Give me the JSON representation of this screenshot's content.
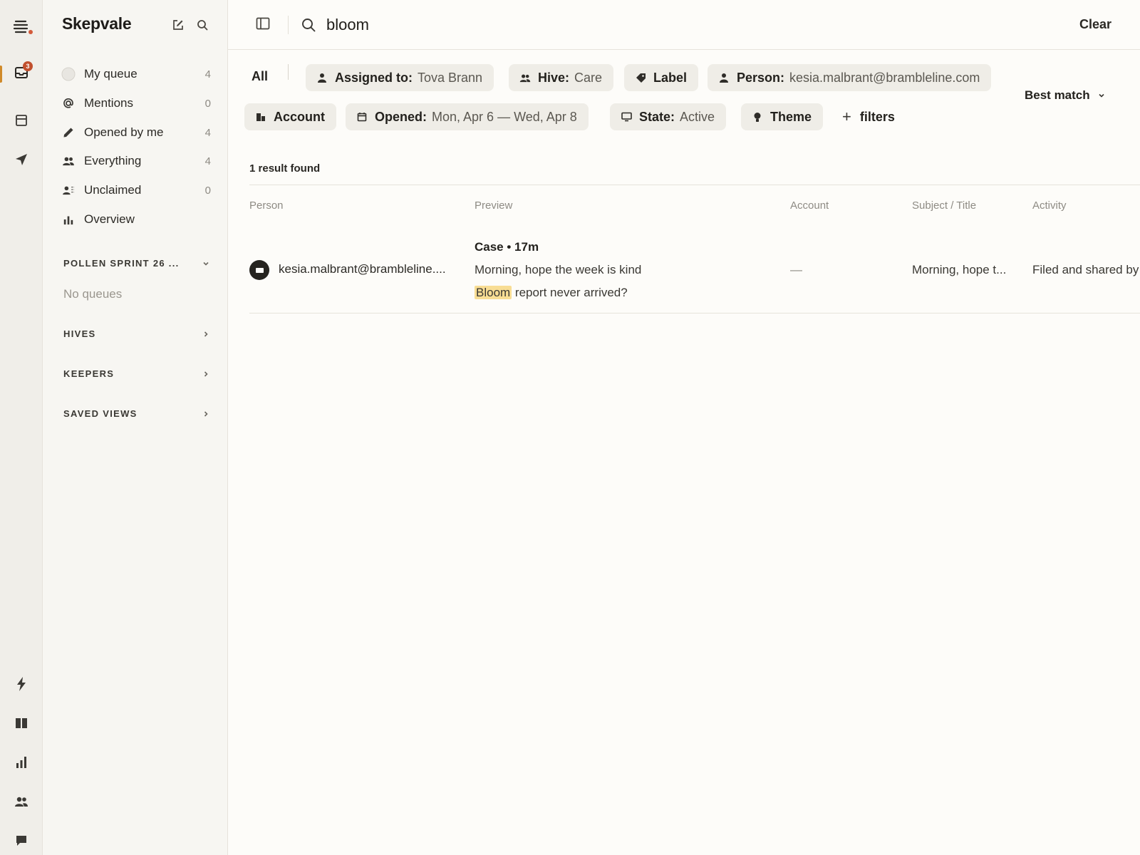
{
  "rail": {
    "inbox_badge": "3",
    "items": [
      "menu-logo",
      "inbox",
      "archive",
      "send",
      "bolt",
      "book",
      "bar-chart",
      "people",
      "chat"
    ]
  },
  "sidebar": {
    "brand": "Skepvale",
    "nav": [
      {
        "label": "My queue",
        "count": "4",
        "icon": "circle-icon"
      },
      {
        "label": "Mentions",
        "count": "0",
        "icon": "at-icon"
      },
      {
        "label": "Opened by me",
        "count": "4",
        "icon": "pencil-icon"
      },
      {
        "label": "Everything",
        "count": "4",
        "icon": "people-icon"
      },
      {
        "label": "Unclaimed",
        "count": "0",
        "icon": "person-dashed-icon"
      },
      {
        "label": "Overview",
        "count": "",
        "icon": "bar-chart-icon"
      }
    ],
    "pollen": {
      "title": "POLLEN SPRINT 26 ...",
      "empty": "No queues"
    },
    "hives": "HIVES",
    "keepers": "KEEPERS",
    "saved_views": "SAVED VIEWS"
  },
  "topbar": {
    "query": "bloom",
    "clear": "Clear"
  },
  "filters": {
    "all": "All",
    "assigned": {
      "key": "Assigned to:",
      "value": "Tova Brann"
    },
    "hive": {
      "key": "Hive:",
      "value": "Care"
    },
    "label": {
      "key": "Label"
    },
    "person": {
      "key": "Person:",
      "value": "kesia.malbrant@brambleline.com"
    },
    "account": {
      "key": "Account"
    },
    "opened": {
      "key": "Opened:",
      "value": "Mon, Apr 6 — Wed, Apr 8"
    },
    "state": {
      "key": "State:",
      "value": "Active"
    },
    "theme": {
      "key": "Theme"
    },
    "add": "filters",
    "sort": "Best match"
  },
  "results": {
    "count_text": "1 result found",
    "columns": [
      "Person",
      "Preview",
      "Account",
      "Subject / Title",
      "Activity"
    ],
    "rows": [
      {
        "person": "kesia.malbrant@brambleline....",
        "preview_head": "Case • 17m",
        "preview_line1": "Morning, hope the week is kind",
        "preview_highlight": "Bloom",
        "preview_line2_rest": " report never arrived?",
        "account": "—",
        "subject": "Morning, hope t...",
        "activity": "Filed and shared by"
      }
    ]
  },
  "colors": {
    "accent": "#d08a2a",
    "badge": "#c1502e",
    "highlight": "#f8dd94",
    "chip_bg": "#efede7"
  }
}
